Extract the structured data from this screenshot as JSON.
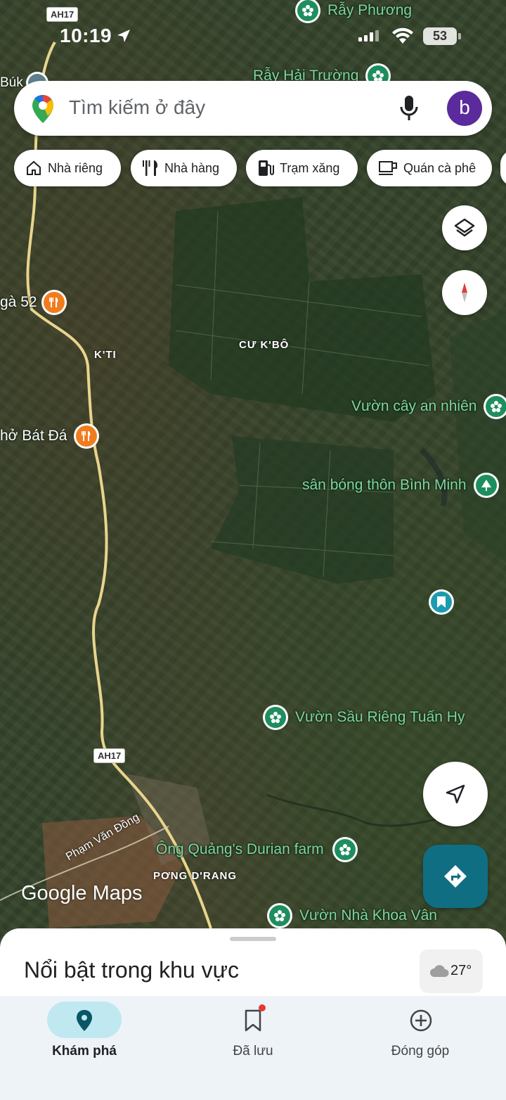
{
  "status_bar": {
    "time": "10:19",
    "battery": "53"
  },
  "search": {
    "placeholder": "Tìm kiếm ở đây",
    "avatar_letter": "b"
  },
  "chips": [
    {
      "label": "Nhà riêng",
      "icon": "home-icon"
    },
    {
      "label": "Nhà hàng",
      "icon": "restaurant-icon"
    },
    {
      "label": "Trạm xăng",
      "icon": "gas-station-icon"
    },
    {
      "label": "Quán cà phê",
      "icon": "coffee-icon"
    }
  ],
  "map": {
    "road_shields": [
      "AH17",
      "AH17"
    ],
    "places": [
      "CƯ K'BÔ",
      "K'TI",
      "PƠNG D'RANG"
    ],
    "streets": [
      "Phạm Văn Đồng"
    ],
    "attribution": "Google Maps",
    "pois": [
      {
        "label": "Rẫy Phương",
        "type": "flower"
      },
      {
        "label": "Rẫy Hải Trường",
        "type": "flower"
      },
      {
        "label": "Vườn cây an nhiên",
        "type": "flower"
      },
      {
        "label": "sân bóng thôn Bình Minh",
        "type": "tree"
      },
      {
        "label": "Vườn Sầu Riêng Tuấn Hy",
        "type": "flower"
      },
      {
        "label": "Ông Quảng's Durian farm",
        "type": "flower"
      },
      {
        "label": "Vườn Nhà Khoa Vân",
        "type": "flower"
      },
      {
        "label": "gà 52",
        "type": "restaurant"
      },
      {
        "label": "hở Bát Đá",
        "type": "restaurant"
      },
      {
        "label": "Búk",
        "type": "other"
      }
    ]
  },
  "sheet": {
    "title": "Nổi bật trong khu vực",
    "temperature": "27°"
  },
  "bottom_nav": [
    {
      "label": "Khám phá",
      "icon": "explore-pin-icon",
      "active": true
    },
    {
      "label": "Đã lưu",
      "icon": "bookmark-icon",
      "active": false
    },
    {
      "label": "Đóng góp",
      "icon": "add-circle-icon",
      "active": false
    }
  ],
  "colors": {
    "poi_green": "#1e8e5e",
    "restaurant_orange": "#f07c1e",
    "directions_teal": "#0f6e82",
    "nav_active_pill": "#bfe8f1"
  }
}
